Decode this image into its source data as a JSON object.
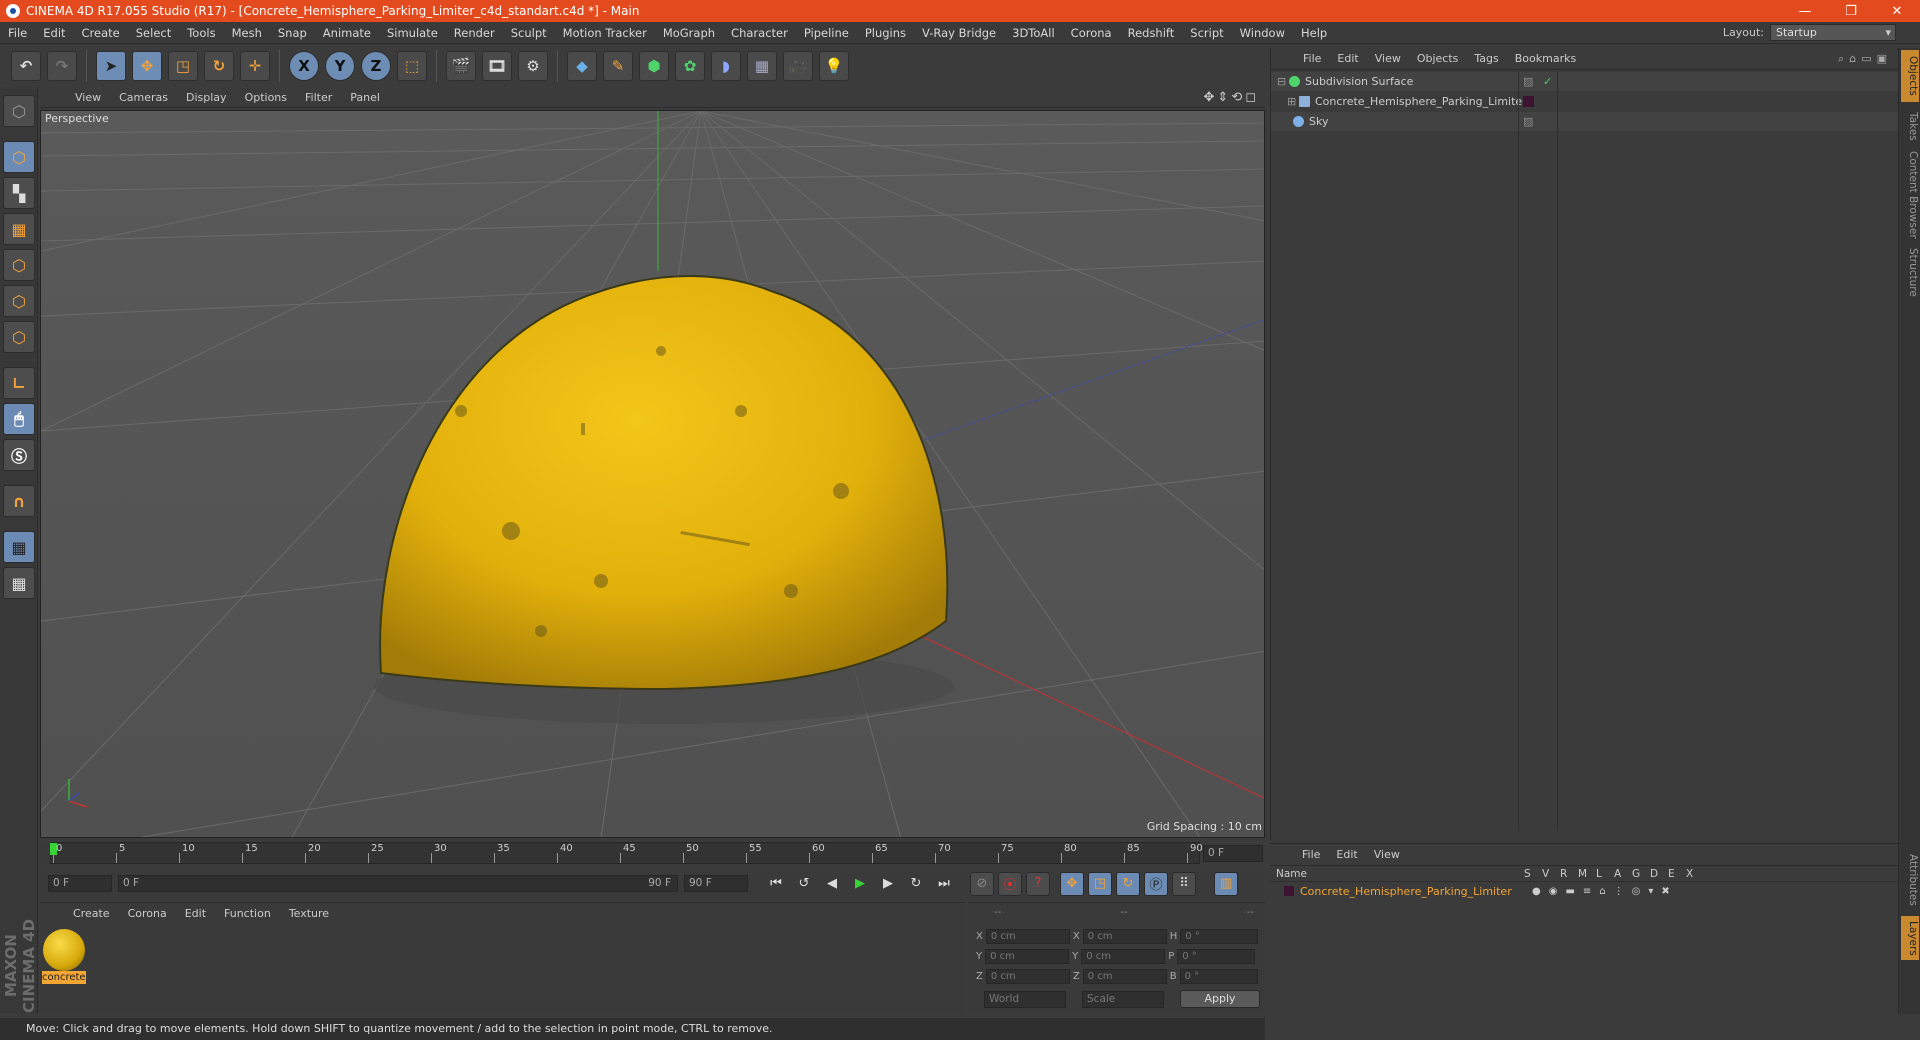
{
  "window": {
    "title": "CINEMA 4D R17.055 Studio (R17) - [Concrete_Hemisphere_Parking_Limiter_c4d_standart.c4d *] - Main",
    "minimize": "—",
    "restore": "❐",
    "close": "✕"
  },
  "menu": [
    "File",
    "Edit",
    "Create",
    "Select",
    "Tools",
    "Mesh",
    "Snap",
    "Animate",
    "Simulate",
    "Render",
    "Sculpt",
    "Motion Tracker",
    "MoGraph",
    "Character",
    "Pipeline",
    "Plugins",
    "V-Ray Bridge",
    "3DToAll",
    "Corona",
    "Redshift",
    "Script",
    "Window",
    "Help"
  ],
  "layout": {
    "label": "Layout:",
    "value": "Startup"
  },
  "toolbar": {
    "x_label": "X",
    "y_label": "Y",
    "z_label": "Z"
  },
  "viewport": {
    "menu": [
      "View",
      "Cameras",
      "Display",
      "Options",
      "Filter",
      "Panel"
    ],
    "label": "Perspective",
    "grid_spacing": "Grid Spacing : 10 cm"
  },
  "timeline": {
    "ticks": [
      "0",
      "5",
      "10",
      "15",
      "20",
      "25",
      "30",
      "35",
      "40",
      "45",
      "50",
      "55",
      "60",
      "65",
      "70",
      "75",
      "80",
      "85",
      "90"
    ],
    "current_frame": "0 F",
    "start_field": "0 F",
    "range_start": "0 F",
    "range_end": "90 F",
    "end_field": "90 F"
  },
  "material_panel": {
    "menu": [
      "Create",
      "Corona",
      "Edit",
      "Function",
      "Texture"
    ],
    "material_name": "concrete"
  },
  "coords": {
    "headers": [
      "--",
      "--",
      "--"
    ],
    "rows": [
      {
        "a": "X",
        "av": "0 cm",
        "b": "X",
        "bv": "0 cm",
        "c": "H",
        "cv": "0 °"
      },
      {
        "a": "Y",
        "av": "0 cm",
        "b": "Y",
        "bv": "0 cm",
        "c": "P",
        "cv": "0 °"
      },
      {
        "a": "Z",
        "av": "0 cm",
        "b": "Z",
        "bv": "0 cm",
        "c": "B",
        "cv": "0 °"
      }
    ],
    "world": "World",
    "scale": "Scale",
    "apply": "Apply"
  },
  "status": "Move: Click and drag to move elements. Hold down SHIFT to quantize movement / add to the selection in point mode, CTRL to remove.",
  "objects_panel": {
    "menu": [
      "File",
      "Edit",
      "View",
      "Objects",
      "Tags",
      "Bookmarks"
    ],
    "items": [
      {
        "name": "Subdivision Surface"
      },
      {
        "name": "Concrete_Hemisphere_Parking_Limiter"
      },
      {
        "name": "Sky"
      }
    ]
  },
  "right_tabs": [
    "Objects",
    "Takes",
    "Content Browser",
    "Structure",
    "Attributes",
    "Layers"
  ],
  "layers_panel": {
    "menu": [
      "File",
      "Edit",
      "View"
    ],
    "columns": [
      "Name",
      "S",
      "V",
      "R",
      "M",
      "L",
      "A",
      "G",
      "D",
      "E",
      "X"
    ],
    "row": "Concrete_Hemisphere_Parking_Limiter"
  },
  "colors": {
    "accent": "#e34a1d",
    "selection": "#f4a635",
    "dome": "#e3b40c"
  }
}
